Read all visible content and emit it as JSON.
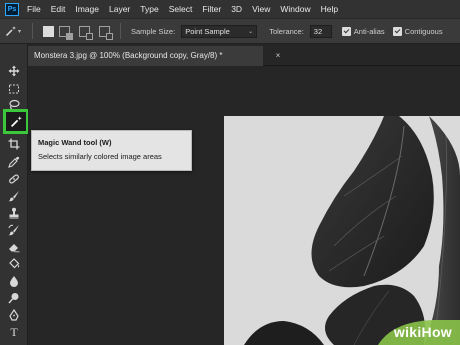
{
  "app": {
    "logo_text": "Ps"
  },
  "menu": [
    "File",
    "Edit",
    "Image",
    "Layer",
    "Type",
    "Select",
    "Filter",
    "3D",
    "View",
    "Window",
    "Help"
  ],
  "options_bar": {
    "tool_icon": "magic-wand-icon",
    "sample_size_label": "Sample Size:",
    "sample_size_value": "Point Sample",
    "tolerance_label": "Tolerance:",
    "tolerance_value": "32",
    "anti_alias_label": "Anti-alias",
    "contiguous_label": "Contiguous",
    "anti_alias_checked": true,
    "contiguous_checked": true
  },
  "document": {
    "tab_title": "Monstera 3.jpg @ 100% (Background copy, Gray/8) *",
    "close_glyph": "×"
  },
  "tooltip": {
    "title": "Magic Wand tool (W)",
    "description": "Selects similarly colored image areas"
  },
  "toolbar": {
    "tools": [
      "move-icon",
      "marquee-icon",
      "lasso-icon",
      "magic-wand-icon",
      "crop-icon",
      "eyedropper-icon",
      "healing-brush-icon",
      "brush-icon",
      "clone-stamp-icon",
      "history-brush-icon",
      "eraser-icon",
      "paint-bucket-icon",
      "blur-icon",
      "dodge-icon",
      "pen-icon",
      "type-icon"
    ],
    "highlight_color": "#3bc83b"
  },
  "watermark": {
    "text": "wikiHow"
  }
}
